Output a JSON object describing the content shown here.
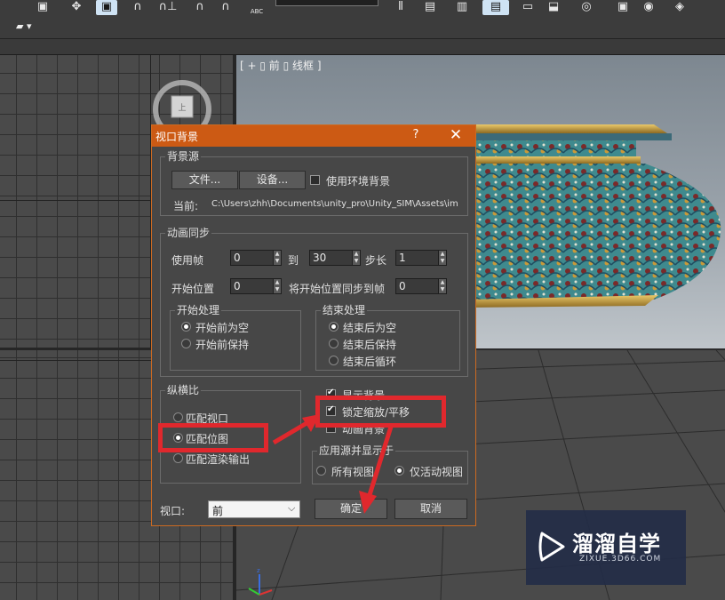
{
  "toolbar": {
    "combo_text": "",
    "abc_label": "ABC"
  },
  "viewport_front": {
    "label": "[ + ▯ 前 ▯ 线框 ]"
  },
  "dialog": {
    "title": "视口背景",
    "help": "?",
    "close": "✕",
    "background_source": {
      "group_label": "背景源",
      "file_button": "文件...",
      "settings_button": "设备...",
      "use_env_bg_label": "使用环境背景",
      "use_env_bg_checked": false,
      "current_label": "当前:",
      "current_path": "C:\\Users\\zhh\\Documents\\unity_pro\\Unity_SIM\\Assets\\im"
    },
    "animation_sync": {
      "group_label": "动画同步",
      "use_frame_label": "使用帧",
      "use_frame_value": "0",
      "to_label": "到",
      "to_value": "30",
      "step_label": "步长",
      "step_value": "1",
      "start_pos_label": "开始位置",
      "start_pos_value": "0",
      "sync_start_label": "将开始位置同步到帧",
      "sync_start_value": "0",
      "start_proc": {
        "group_label": "开始处理",
        "options": [
          "开始前为空",
          "开始前保持"
        ],
        "selected": 0
      },
      "end_proc": {
        "group_label": "结束处理",
        "options": [
          "结束后为空",
          "结束后保持",
          "结束后循环"
        ],
        "selected": 0
      }
    },
    "aspect": {
      "group_label": "纵横比",
      "options": [
        "匹配视口",
        "匹配位图",
        "匹配渲染输出"
      ],
      "selected": 1
    },
    "checks": {
      "show_bg": "显示背景",
      "lock_zoom": "锁定缩放/平移",
      "animate_bg": "动画背景",
      "show_bg_checked": true,
      "lock_zoom_checked": true,
      "animate_bg_checked": false
    },
    "apply_source": {
      "group_label": "应用源并显示于",
      "options": [
        "所有视图",
        "仅活动视图"
      ],
      "selected": 1
    },
    "viewport_label": "视口:",
    "viewport_value": "前",
    "ok_button": "确定",
    "cancel_button": "取消"
  },
  "watermark": {
    "title": "溜溜自学",
    "url": "ZIXUE.3D66.COM"
  },
  "colors": {
    "dialog_title": "#cc5a14",
    "highlight": "#e0282d",
    "viewport_grid": "#4a4a4a"
  }
}
